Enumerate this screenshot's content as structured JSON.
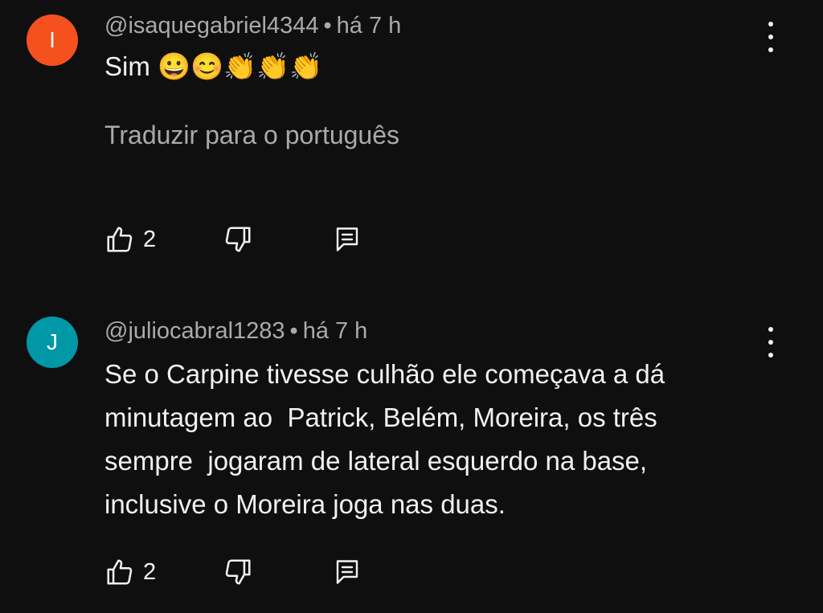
{
  "comments": [
    {
      "avatar_letter": "I",
      "avatar_color": "#f4511e",
      "author": "@isaquegabriel4344",
      "separator": "•",
      "time": "há 7 h",
      "text": "Sim 😀😊👏👏👏",
      "translate_label": "Traduzir para o português",
      "likes": "2"
    },
    {
      "avatar_letter": "J",
      "avatar_color": "#0097a7",
      "author": "@juliocabral1283",
      "separator": "•",
      "time": "há 7 h",
      "text": "Se o Carpine tivesse culhão ele começava a dá\nminutagem ao  Patrick, Belém, Moreira, os três\nsempre  jogaram de lateral esquerdo na base,\ninclusive o Moreira joga nas duas.",
      "likes": "2"
    }
  ],
  "icons": {
    "like": "thumbs-up-icon",
    "dislike": "thumbs-down-icon",
    "reply": "comment-reply-icon",
    "more": "more-vert-icon"
  }
}
